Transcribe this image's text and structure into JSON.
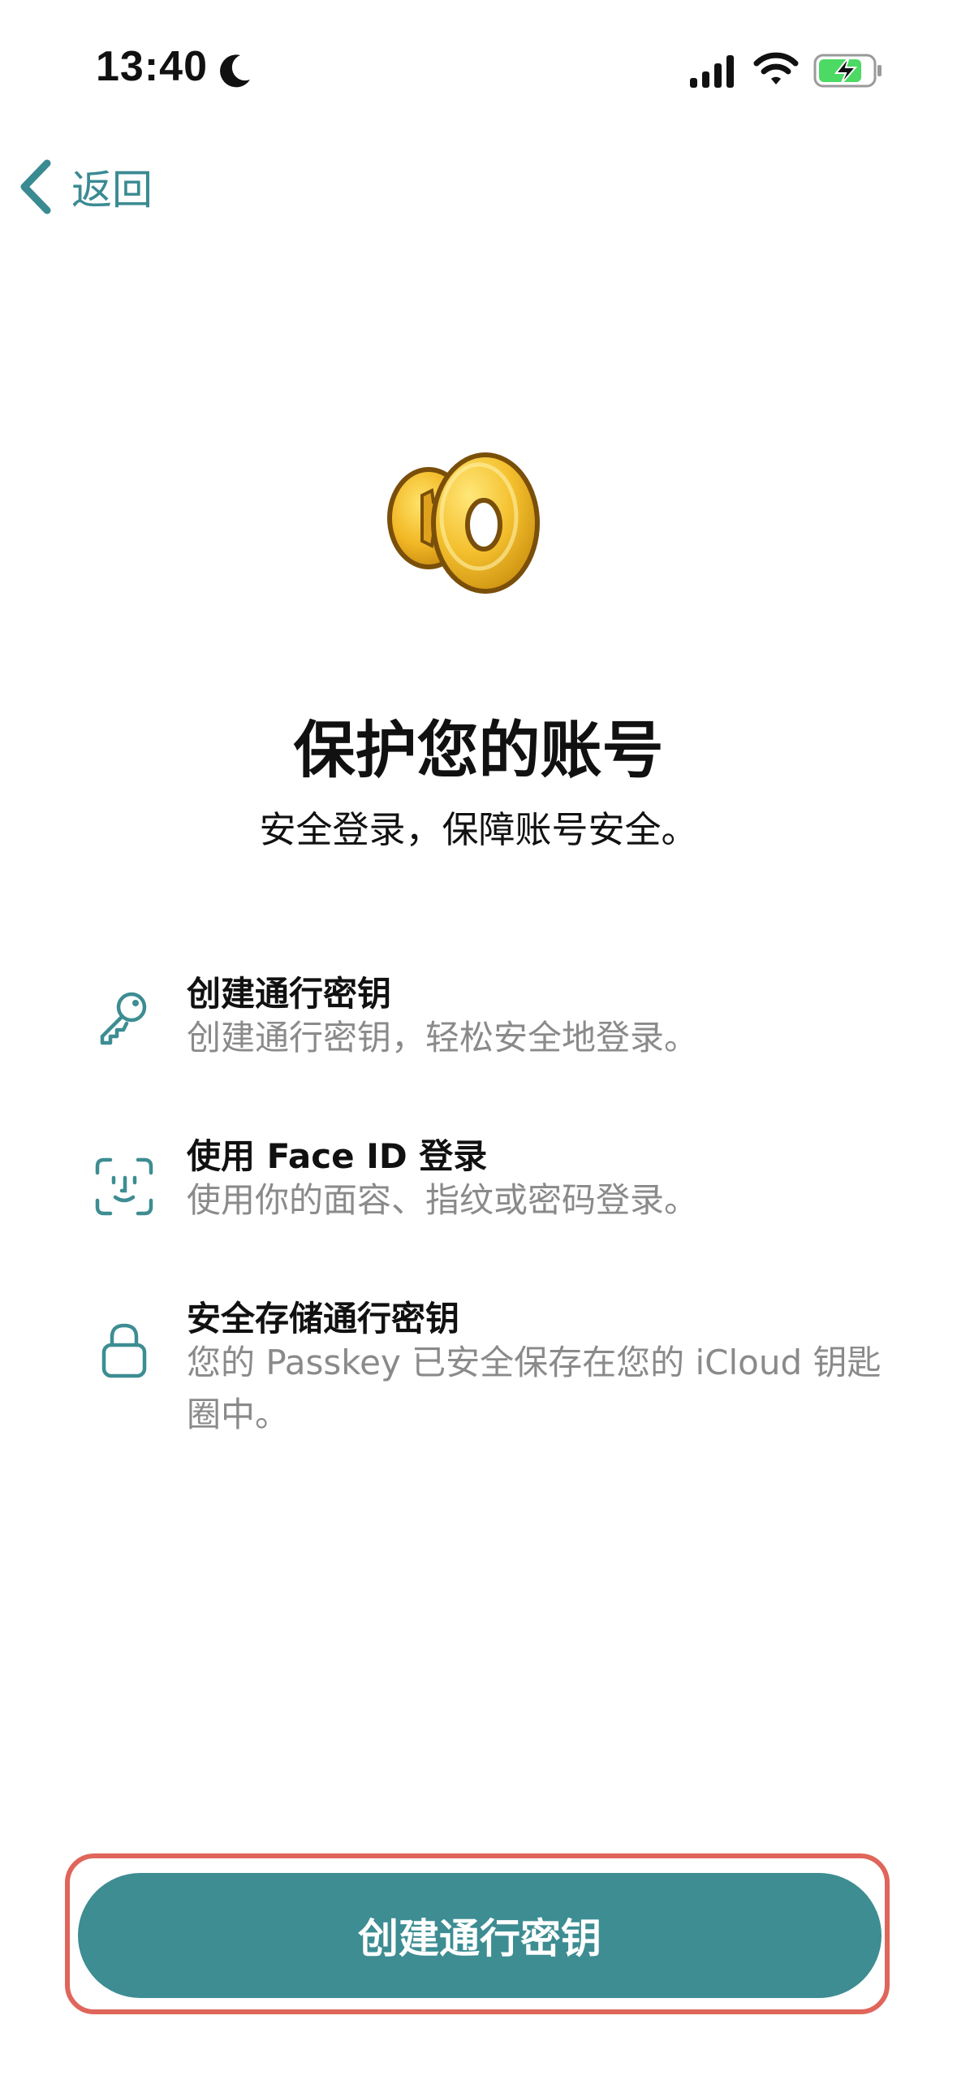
{
  "status_bar": {
    "time": "13:40",
    "icons": [
      "moon-icon",
      "signal-icon",
      "wifi-icon",
      "battery-charging-icon"
    ]
  },
  "nav": {
    "back_label": "返回"
  },
  "hero": {
    "icon": "passkey-icon",
    "title": "保护您的账号",
    "subtitle": "安全登录，保障账号安全。"
  },
  "features": [
    {
      "icon": "key-icon",
      "title": "创建通行密钥",
      "description": "创建通行密钥，轻松安全地登录。"
    },
    {
      "icon": "face-id-icon",
      "title": "使用 Face ID 登录",
      "description": "使用你的面容、指纹或密码登录。"
    },
    {
      "icon": "lock-icon",
      "title": "安全存储通行密钥",
      "description": "您的 Passkey 已安全保存在您的 iCloud 钥匙圈中。"
    }
  ],
  "cta": {
    "label": "创建通行密钥"
  },
  "colors": {
    "accent": "#3d8d92",
    "back_link": "#3a8a92",
    "secondary_text": "#8a8a8a",
    "highlight_outline": "#e0655a"
  }
}
